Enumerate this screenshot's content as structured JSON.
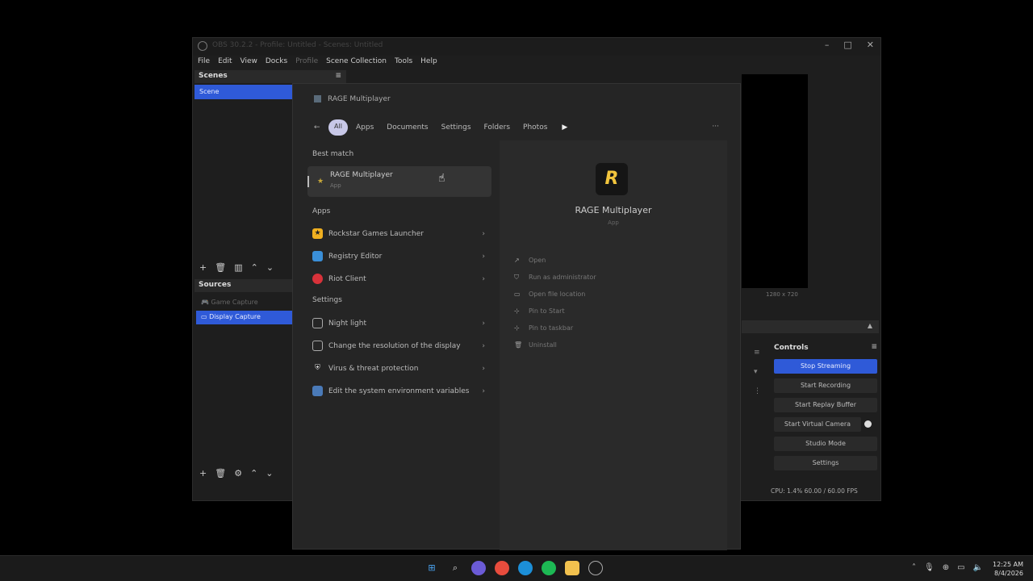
{
  "obs": {
    "title": "OBS 30.2.2 - Profile: Untitled - Scenes: Untitled",
    "menu": [
      "File",
      "Edit",
      "View",
      "Docks",
      "Profile",
      "Scene Collection",
      "Tools",
      "Help"
    ],
    "scenes_header": "Scenes",
    "scene_item": "Scene",
    "sources_header": "Sources",
    "sources": [
      "Game Capture",
      "Display Capture"
    ],
    "preview_caption": "1280 x 720",
    "controls_header": "Controls",
    "controls": [
      "Stop Streaming",
      "Start Recording",
      "Start Replay Buffer",
      "Start Virtual Camera",
      "Studio Mode",
      "Settings"
    ],
    "status": "CPU: 1.4%   60.00 / 60.00 FPS"
  },
  "start": {
    "search_text": "RAGE Multiplayer",
    "tab_all": "All",
    "tabs": [
      "Apps",
      "Documents",
      "Settings",
      "Folders",
      "Photos"
    ],
    "best_match_label": "Best match",
    "best_match": {
      "name": "RAGE Multiplayer",
      "type": "App"
    },
    "apps_label": "Apps",
    "apps": [
      {
        "name": "Rockstar Games Launcher",
        "icon": "rockstar-icon",
        "color": "#f0b020"
      },
      {
        "name": "Registry Editor",
        "icon": "registry-icon",
        "color": "#3a8fd8"
      },
      {
        "name": "Riot Client",
        "icon": "riot-icon",
        "color": "#d8323a"
      }
    ],
    "settings_label": "Settings",
    "settings": [
      {
        "name": "Night light",
        "icon": "monitor-icon"
      },
      {
        "name": "Change the resolution of the display",
        "icon": "monitor-icon"
      },
      {
        "name": "Virus & threat protection",
        "icon": "shield-icon"
      },
      {
        "name": "Edit the system environment variables",
        "icon": "system-icon"
      }
    ],
    "preview": {
      "logo_letter": "R",
      "name": "RAGE Multiplayer",
      "type": "App",
      "actions": [
        {
          "label": "Open",
          "icon": "open-icon"
        },
        {
          "label": "Run as administrator",
          "icon": "admin-icon"
        },
        {
          "label": "Open file location",
          "icon": "folder-icon"
        },
        {
          "label": "Pin to Start",
          "icon": "pin-icon"
        },
        {
          "label": "Pin to taskbar",
          "icon": "pin-icon"
        },
        {
          "label": "Uninstall",
          "icon": "trash-icon"
        }
      ]
    }
  },
  "taskbar": {
    "time": "12:25 AM",
    "date": "8/4/2026"
  }
}
